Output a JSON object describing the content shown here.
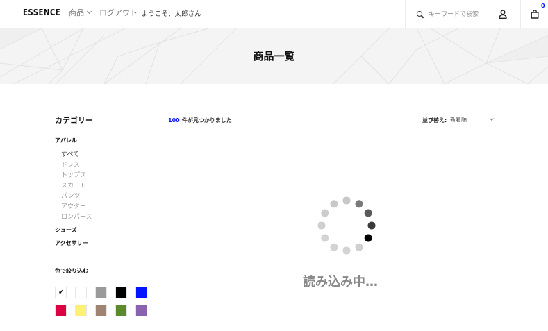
{
  "header": {
    "logo": "ESSENCE",
    "nav": {
      "products_label": "商品",
      "logout_label": "ログアウト",
      "welcome_text": "ようこそ、太郎さん"
    },
    "search": {
      "placeholder": "キーワードで検索"
    },
    "cart": {
      "count": "0"
    }
  },
  "hero": {
    "title": "商品一覧"
  },
  "sidebar": {
    "heading": "カテゴリー",
    "groups": [
      {
        "label": "アパレル",
        "items": [
          "すべて",
          "ドレス",
          "トップス",
          "スカート",
          "パンツ",
          "アウター",
          "ロンパース"
        ]
      },
      {
        "label": "シューズ",
        "items": []
      },
      {
        "label": "アクセサリー",
        "items": []
      }
    ],
    "active_item": "すべて",
    "color_filter": {
      "heading": "色で絞り込む",
      "colors": [
        "#ffffff",
        "#ffffff",
        "#9a9a9a",
        "#000000",
        "#0315ff",
        "#dc0345",
        "#fff176",
        "#9e8471",
        "#5a8a2a",
        "#8a63b0"
      ],
      "selected_index": 0,
      "check_glyph": "✔"
    }
  },
  "main": {
    "result_count": "100",
    "result_suffix": "件が見つかりました",
    "sort": {
      "label": "並び替え:",
      "selected": "新着順"
    },
    "loading_text": "読み込み中…"
  },
  "icons": {
    "search": "search-icon",
    "user": "user-icon",
    "cart": "cart-icon"
  }
}
